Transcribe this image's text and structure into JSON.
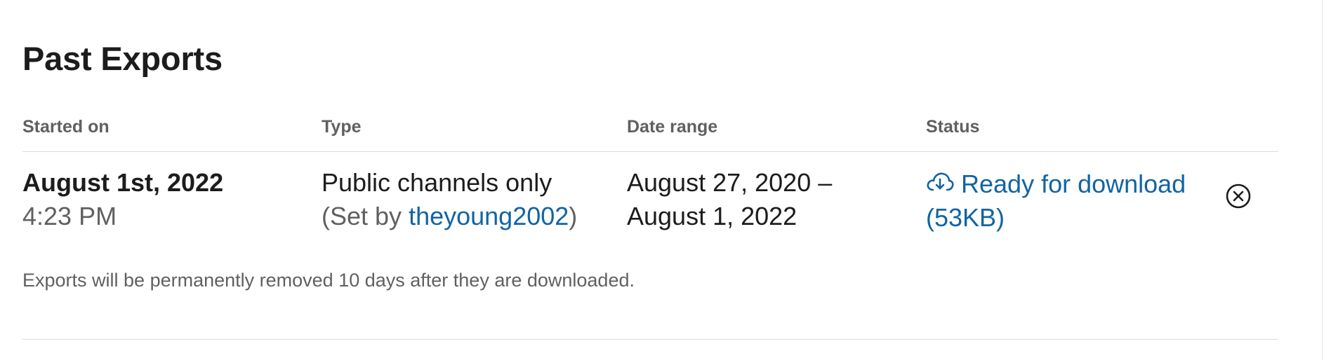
{
  "page": {
    "title": "Past Exports"
  },
  "table": {
    "headers": {
      "started_on": "Started on",
      "type": "Type",
      "date_range": "Date range",
      "status": "Status"
    },
    "rows": [
      {
        "started_date": "August 1st, 2022",
        "started_time": "4:23 PM",
        "type": "Public channels only",
        "set_by_prefix": "(Set by ",
        "set_by_user": "theyoung2002",
        "set_by_suffix": ")",
        "range_start": "August 27, 2020 –",
        "range_end": "August 1, 2022",
        "status_line1": "Ready for download",
        "status_line2": "(53KB)",
        "status_icon": "cloud-download-icon",
        "remove_icon": "close-circle-icon"
      }
    ]
  },
  "footer": {
    "note": "Exports will be permanently removed 10 days after they are downloaded."
  },
  "colors": {
    "link": "#1264a3",
    "muted": "#616061",
    "text": "#1d1c1d",
    "divider": "#dddddd"
  }
}
